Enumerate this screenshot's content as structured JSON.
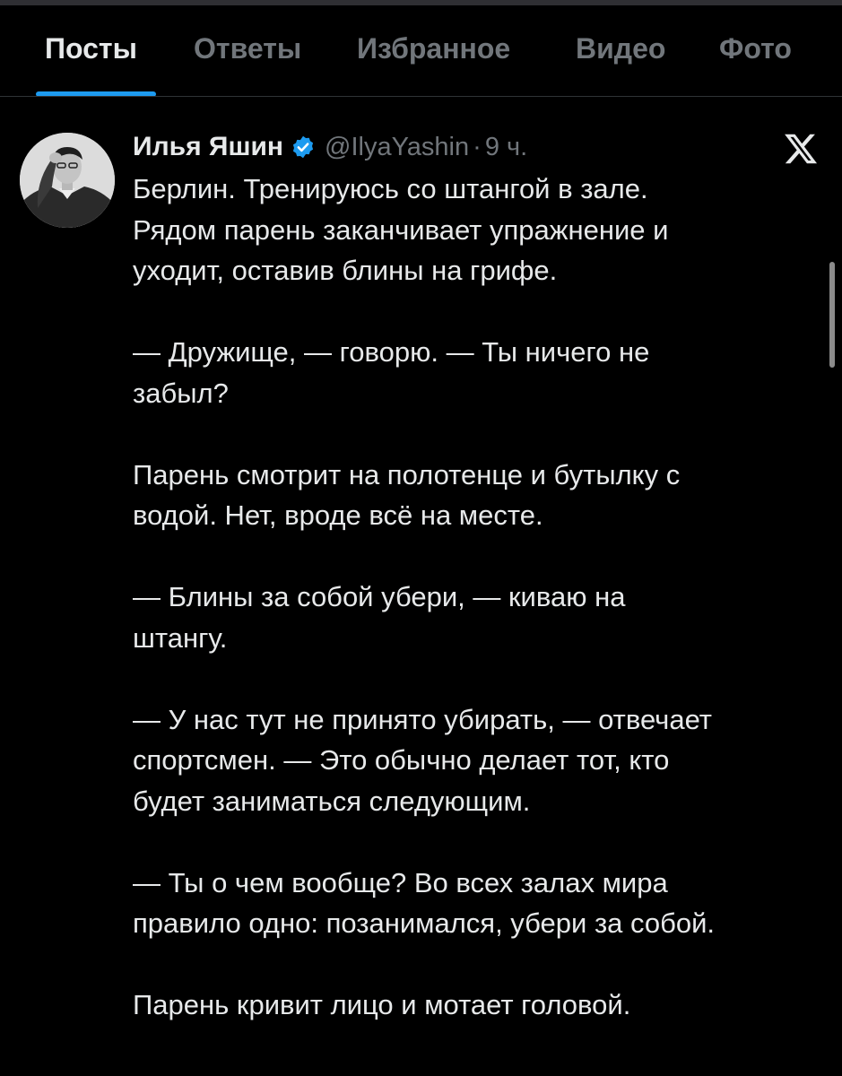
{
  "tabs": [
    {
      "label": "Посты",
      "active": true
    },
    {
      "label": "Ответы",
      "active": false
    },
    {
      "label": "Избранное",
      "active": false
    },
    {
      "label": "Видео",
      "active": false
    },
    {
      "label": "Фото",
      "active": false
    }
  ],
  "post": {
    "author_name": "Илья Яшин",
    "verified_icon": "verified-badge-icon",
    "handle": "@IlyaYashin",
    "separator": "·",
    "time": "9 ч.",
    "paragraphs": [
      "Берлин. Тренируюсь со штангой в зале.\nРядом парень заканчивает упражнение и\nуходит, оставив блины на грифе.",
      "— Дружище, — говорю. — Ты ничего не\nзабыл?",
      "Парень смотрит на полотенце и бутылку с\nводой. Нет, вроде всё на месте.",
      "— Блины за собой убери, — киваю на\nштангу.",
      "— У нас тут не принято убирать, — отвечает\nспортсмен. — Это обычно делает тот, кто\nбудет заниматься следующим.",
      "— Ты о чем вообще? Во всех залах мира\nправило одно: позанимался, убери за собой.",
      "Парень кривит лицо и мотает головой."
    ]
  },
  "colors": {
    "background": "#000000",
    "text_primary": "#e7e9ea",
    "text_secondary": "#71767b",
    "accent": "#1d9bf0"
  }
}
